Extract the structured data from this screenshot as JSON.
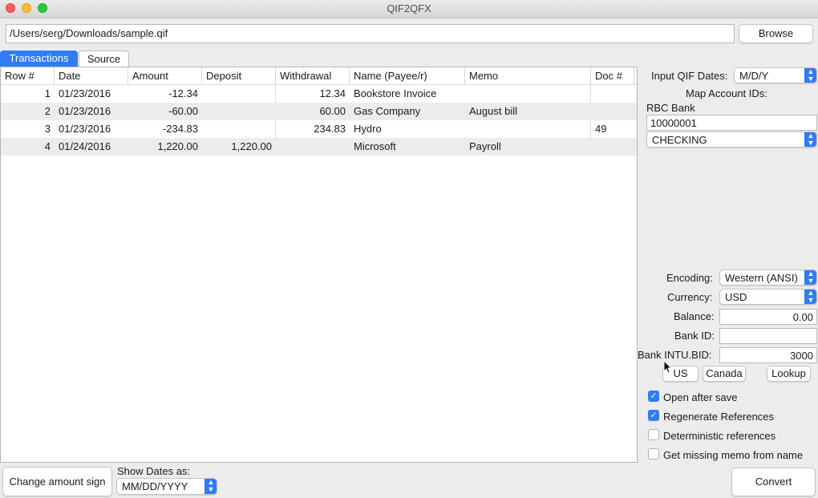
{
  "window": {
    "title": "QIF2QFX"
  },
  "file": {
    "path": "/Users/serg/Downloads/sample.qif",
    "browse_label": "Browse"
  },
  "tabs": [
    {
      "label": "Transactions",
      "active": true
    },
    {
      "label": "Source",
      "active": false
    }
  ],
  "table": {
    "columns": [
      "Row #",
      "Date",
      "Amount",
      "Deposit",
      "Withdrawal",
      "Name (Payee/r)",
      "Memo",
      "Doc #"
    ],
    "rows": [
      {
        "row": "1",
        "date": "01/23/2016",
        "amount": "-12.34",
        "deposit": "",
        "withdrawal": "12.34",
        "name": "Bookstore Invoice",
        "memo": "",
        "doc": ""
      },
      {
        "row": "2",
        "date": "01/23/2016",
        "amount": "-60.00",
        "deposit": "",
        "withdrawal": "60.00",
        "name": "Gas Company",
        "memo": "August bill",
        "doc": ""
      },
      {
        "row": "3",
        "date": "01/23/2016",
        "amount": "-234.83",
        "deposit": "",
        "withdrawal": "234.83",
        "name": "Hydro",
        "memo": "",
        "doc": "49"
      },
      {
        "row": "4",
        "date": "01/24/2016",
        "amount": "1,220.00",
        "deposit": "1,220.00",
        "withdrawal": "",
        "name": "Microsoft",
        "memo": "Payroll",
        "doc": ""
      }
    ]
  },
  "panel": {
    "input_dates_label": "Input QIF Dates:",
    "input_dates_value": "M/D/Y",
    "map_ids_label": "Map Account IDs:",
    "bank_name": "RBC Bank",
    "account_id": "10000001",
    "account_type": "CHECKING",
    "encoding_label": "Encoding:",
    "encoding_value": "Western (ANSI)",
    "currency_label": "Currency:",
    "currency_value": "USD",
    "balance_label": "Balance:",
    "balance_value": "0.00",
    "bank_id_label": "Bank ID:",
    "bank_id_value": "",
    "intu_bid_label": "Bank INTU.BID:",
    "intu_bid_value": "3000",
    "us_label": "US",
    "canada_label": "Canada",
    "lookup_label": "Lookup",
    "options": [
      {
        "label": "Open after save",
        "checked": true
      },
      {
        "label": "Regenerate References",
        "checked": true
      },
      {
        "label": "Deterministic references",
        "checked": false
      },
      {
        "label": "Get missing memo from name",
        "checked": false
      }
    ],
    "convert_label": "Convert"
  },
  "bottom": {
    "change_sign_label": "Change amount sign",
    "show_dates_label": "Show Dates as:",
    "show_dates_value": "MM/DD/YYYY"
  },
  "colors": {
    "accent": "#2f7df6"
  }
}
